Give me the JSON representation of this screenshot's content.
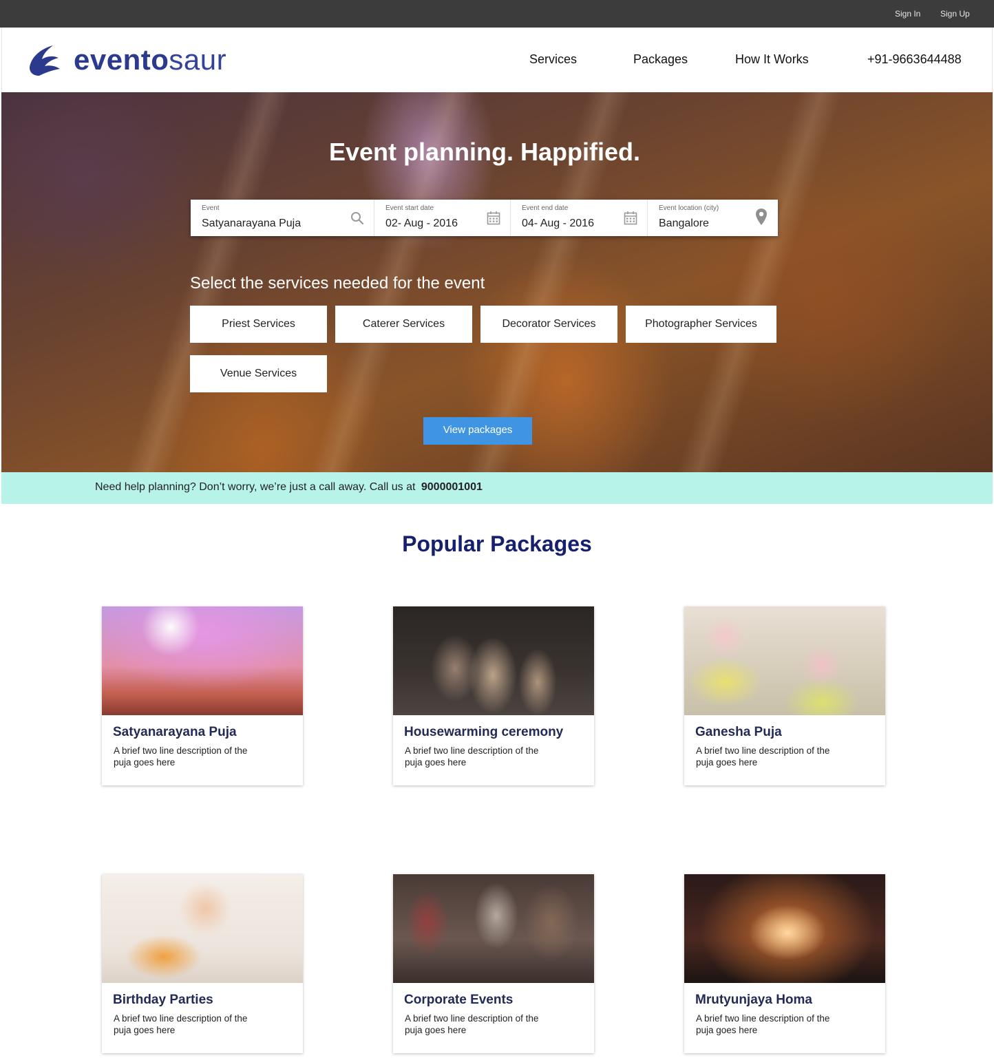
{
  "topbar": {
    "sign_in": "Sign In",
    "sign_up": "Sign Up"
  },
  "header": {
    "logo_bold": "evento",
    "logo_light": "saur",
    "nav": {
      "services": "Services",
      "packages": "Packages",
      "how_it_works": "How It Works",
      "phone": "+91-9663644488"
    }
  },
  "hero": {
    "title": "Event planning. Happified.",
    "search": {
      "event": {
        "label": "Event",
        "value": "Satyanarayana Puja",
        "icon": "search-icon"
      },
      "start_date": {
        "label": "Event start date",
        "value": "02- Aug - 2016",
        "icon": "calendar-icon"
      },
      "end_date": {
        "label": "Event end date",
        "value": "04- Aug - 2016",
        "icon": "calendar-icon"
      },
      "location": {
        "label": "Event location (city)",
        "value": "Bangalore",
        "icon": "location-pin-icon"
      }
    },
    "services_title": "Select the services needed for the event",
    "services": [
      "Priest Services",
      "Caterer Services",
      "Decorator Services",
      "Photographer Services",
      "Venue Services"
    ],
    "view_packages": "View packages"
  },
  "help": {
    "text": "Need help planning? Don’t worry, we’re just a call away. Call us at",
    "number": "9000001001"
  },
  "packages": {
    "title": "Popular Packages",
    "items": [
      {
        "title": "Satyanarayana Puja",
        "desc": "A brief two line description of the puja goes here"
      },
      {
        "title": "Housewarming ceremony",
        "desc": "A brief two line description of the puja goes here"
      },
      {
        "title": "Ganesha Puja",
        "desc": "A brief two line description of the puja goes here"
      },
      {
        "title": "Birthday Parties",
        "desc": "A brief two line description of the puja goes here"
      },
      {
        "title": "Corporate Events",
        "desc": "A brief two line description of the puja goes here"
      },
      {
        "title": "Mrutyunjaya Homa",
        "desc": "A brief two line description of the puja goes here"
      }
    ]
  },
  "colors": {
    "brand": "#2b3a8c",
    "heading": "#16206e",
    "accent_button": "#3f95e3",
    "help_bar": "#b8f3ea",
    "topbar": "#3c3c3c"
  }
}
